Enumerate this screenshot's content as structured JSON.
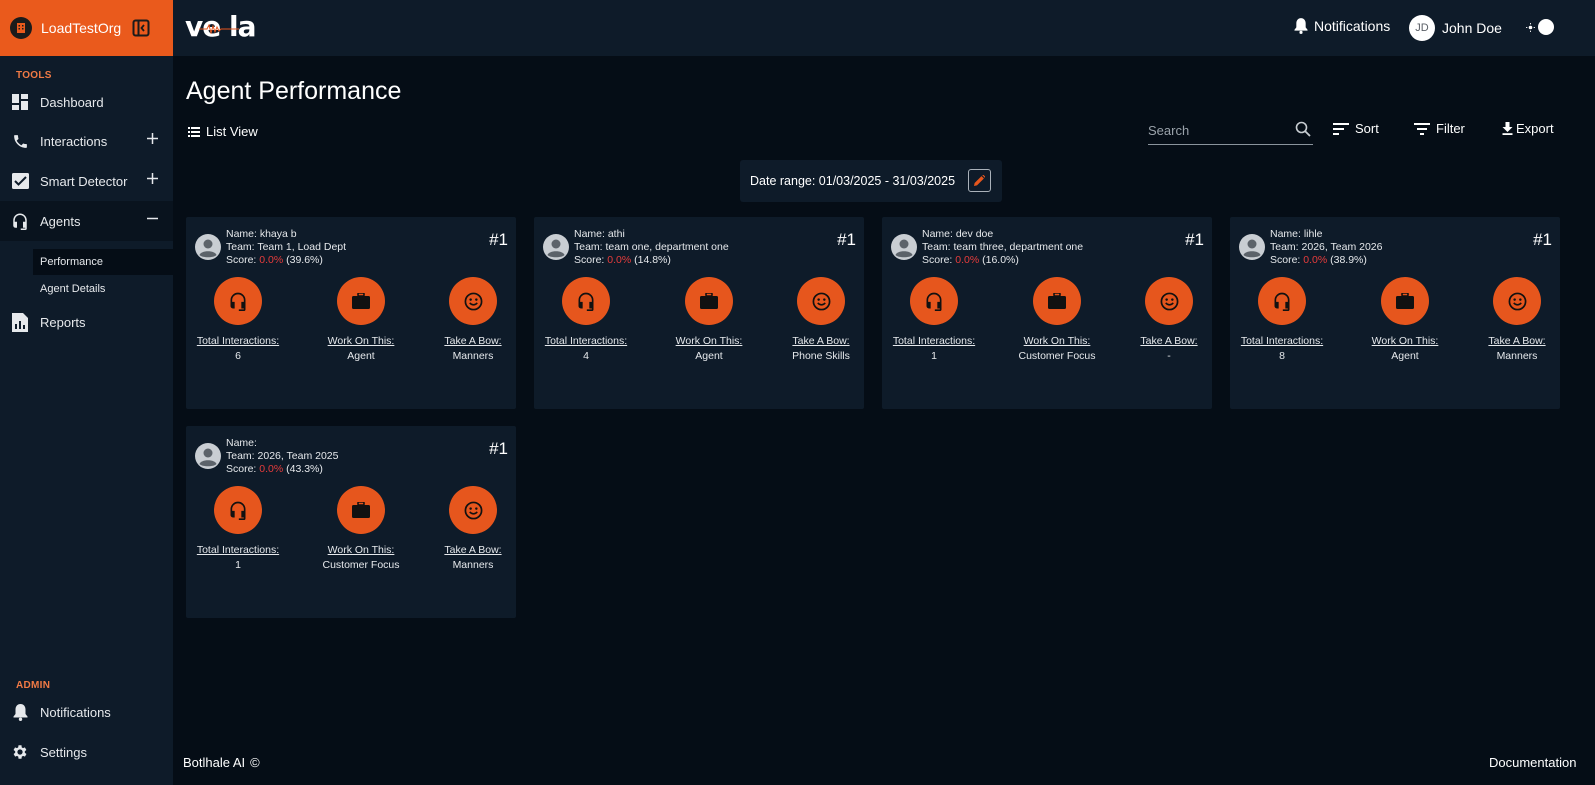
{
  "org": {
    "name": "LoadTestOrg"
  },
  "sidebar": {
    "tools_label": "TOOLS",
    "admin_label": "ADMIN",
    "items": [
      {
        "label": "Dashboard",
        "icon": "dashboard-icon"
      },
      {
        "label": "Interactions",
        "icon": "phone-icon"
      },
      {
        "label": "Smart Detector",
        "icon": "check-box-icon"
      },
      {
        "label": "Agents",
        "icon": "headset-icon"
      },
      {
        "label": "Reports",
        "icon": "report-icon"
      }
    ],
    "sub_items": [
      {
        "label": "Performance"
      },
      {
        "label": "Agent Details"
      }
    ],
    "admin_items": [
      {
        "label": "Notifications",
        "icon": "bell-icon"
      },
      {
        "label": "Settings",
        "icon": "gear-icon"
      }
    ]
  },
  "topbar": {
    "logo": "ve  la",
    "notifications_label": "Notifications",
    "user_initials": "JD",
    "user_name": "John Doe"
  },
  "main": {
    "title": "Agent Performance",
    "list_view_label": "List View",
    "search_placeholder": "Search",
    "sort_label": "Sort",
    "filter_label": "Filter",
    "export_label": "Export",
    "date_range": "Date range: 01/03/2025 - 31/03/2025"
  },
  "metric_labels": {
    "interactions": "Total Interactions:",
    "work_on": "Work On This:",
    "take_bow": "Take A Bow:"
  },
  "agents": [
    {
      "name": "Name: khaya b",
      "team": "Team: Team 1, Load Dept",
      "score_prefix": "Score: ",
      "score": "0.0%",
      "score_pct": " (39.6%)",
      "rank": "#1",
      "interactions": "6",
      "work_on": "Agent",
      "take_bow": "Manners"
    },
    {
      "name": "Name: athi",
      "team": "Team: team one, department one",
      "score_prefix": "Score: ",
      "score": "0.0%",
      "score_pct": " (14.8%)",
      "rank": "#1",
      "interactions": "4",
      "work_on": "Agent",
      "take_bow": "Phone Skills"
    },
    {
      "name": "Name: dev doe",
      "team": "Team: team three, department one",
      "score_prefix": "Score: ",
      "score": "0.0%",
      "score_pct": " (16.0%)",
      "rank": "#1",
      "interactions": "1",
      "work_on": "Customer Focus",
      "take_bow": "-"
    },
    {
      "name": "Name: lihle",
      "team": "Team: 2026, Team 2026",
      "score_prefix": "Score: ",
      "score": "0.0%",
      "score_pct": " (38.9%)",
      "rank": "#1",
      "interactions": "8",
      "work_on": "Agent",
      "take_bow": "Manners"
    },
    {
      "name": "Name:",
      "team": "Team: 2026, Team 2025",
      "score_prefix": "Score: ",
      "score": "0.0%",
      "score_pct": " (43.3%)",
      "rank": "#1",
      "interactions": "1",
      "work_on": "Customer Focus",
      "take_bow": "Manners"
    }
  ],
  "footer": {
    "company": "Botlhale AI",
    "copyright": "©",
    "documentation": "Documentation"
  },
  "colors": {
    "accent": "#ea5a1c",
    "score_red": "#e63c3c",
    "panel": "#0e1b29",
    "background": "#050d16"
  }
}
